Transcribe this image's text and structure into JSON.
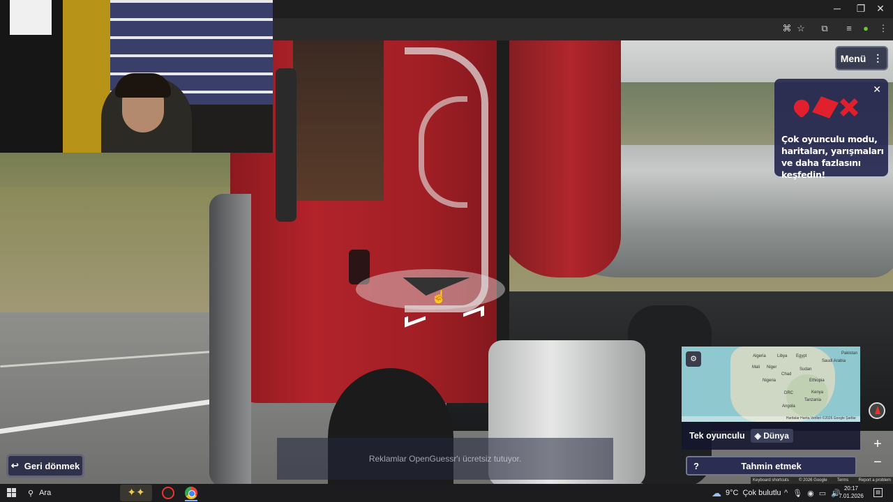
{
  "browser": {
    "window_controls": {
      "minimize": "─",
      "restore": "❐",
      "close": "✕"
    },
    "toolbar_icons": [
      "translate-icon",
      "star-icon",
      "extensions-icon",
      "reading-list-icon",
      "profile-icon",
      "more-icon"
    ]
  },
  "game": {
    "menu_label": "Menü",
    "promo": {
      "text": "Çok oyunculu modu, haritaları, yarışmaları ve daha fazlasını keşfedin!",
      "close": "✕",
      "icon_color": "#e0212d"
    },
    "minimap": {
      "labels": [
        "Algeria",
        "Libya",
        "Egypt",
        "Saudi Arabia",
        "Pakistan",
        "Mali",
        "Niger",
        "Sudan",
        "Nigeria",
        "Chad",
        "Ethiopia",
        "DRC",
        "Kenya",
        "Tanzania",
        "Angola"
      ],
      "footer": "Haritalar   Harita Verileri ©2026 Google   Şartlar"
    },
    "mode_label": "Tek oyunculu",
    "map_badge": "Dünya",
    "guess_button": "Tahmin etmek",
    "guess_icon": "?",
    "back_button": "Geri dönmek",
    "ad_text": "Reklamlar OpenGuessr'ı ücretsiz tutuyor.",
    "zoom_in": "+",
    "zoom_out": "−",
    "footer_links": [
      "Keyboard shortcuts",
      "© 2026 Google",
      "Terms",
      "Report a problem"
    ]
  },
  "taskbar": {
    "search_label": "Ara",
    "weather": "9°C",
    "weather_desc": "Çok bulutlu",
    "time": "20:17",
    "date": "7.01.2026"
  }
}
